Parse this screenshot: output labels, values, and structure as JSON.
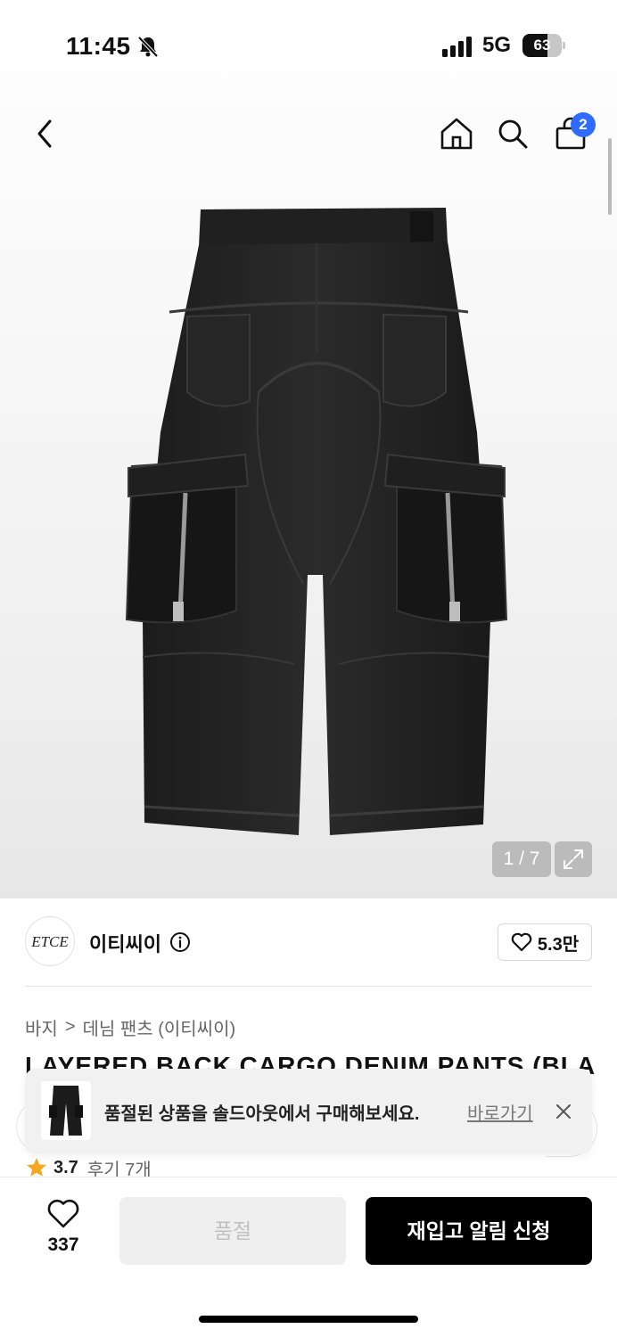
{
  "status_bar": {
    "time": "11:45",
    "network": "5G",
    "battery_level": "63",
    "battery_fraction": 0.63
  },
  "nav": {
    "cart_badge": "2"
  },
  "gallery": {
    "counter": "1 / 7"
  },
  "brand": {
    "logo_text": "ETCE",
    "name": "이티씨이",
    "likes": "5.3만"
  },
  "breadcrumb": {
    "category": "바지",
    "subcategory": "데님 팬츠 (이티씨이)",
    "separator": ">"
  },
  "product": {
    "title": "LAYERED BACK CARGO DENIM PANTS (BLACK)"
  },
  "toast": {
    "message": "품절된 상품을 솔드아웃에서 구매해보세요.",
    "link": "바로가기"
  },
  "rating": {
    "score": "3.7",
    "reviews": "후기 7개"
  },
  "bottom_bar": {
    "wish_count": "337",
    "soldout_label": "품절",
    "restock_label": "재입고 알림 신청"
  },
  "colors": {
    "badge": "#2f6bff",
    "star": "#f5a623",
    "primary_button": "#000000",
    "disabled_button": "#efefef"
  },
  "icons": [
    "bell-slash-icon",
    "signal-icon",
    "back-icon",
    "home-icon",
    "search-icon",
    "cart-icon",
    "expand-icon",
    "info-icon",
    "heart-icon",
    "chevron-right-icon",
    "close-icon",
    "star-icon"
  ]
}
